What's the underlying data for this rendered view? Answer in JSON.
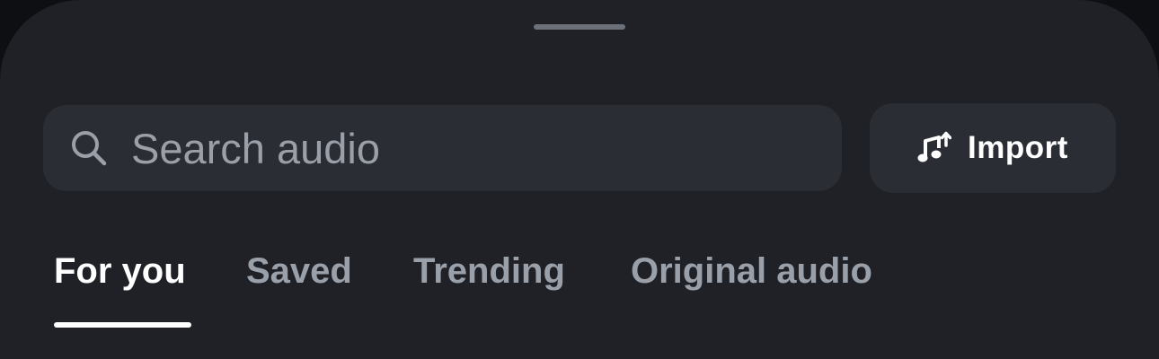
{
  "search": {
    "placeholder": "Search audio",
    "value": "",
    "icon": "search-icon"
  },
  "import_button": {
    "label": "Import",
    "icon": "music-upload-icon"
  },
  "tabs": [
    {
      "label": "For you",
      "active": true
    },
    {
      "label": "Saved",
      "active": false
    },
    {
      "label": "Trending",
      "active": false
    },
    {
      "label": "Original audio",
      "active": false
    }
  ],
  "colors": {
    "sheet_background": "#1f2126",
    "field_background": "#2a2d33",
    "active_tab": "#ffffff",
    "inactive_tab": "#9aa0aa",
    "placeholder": "#9a9fa8"
  }
}
